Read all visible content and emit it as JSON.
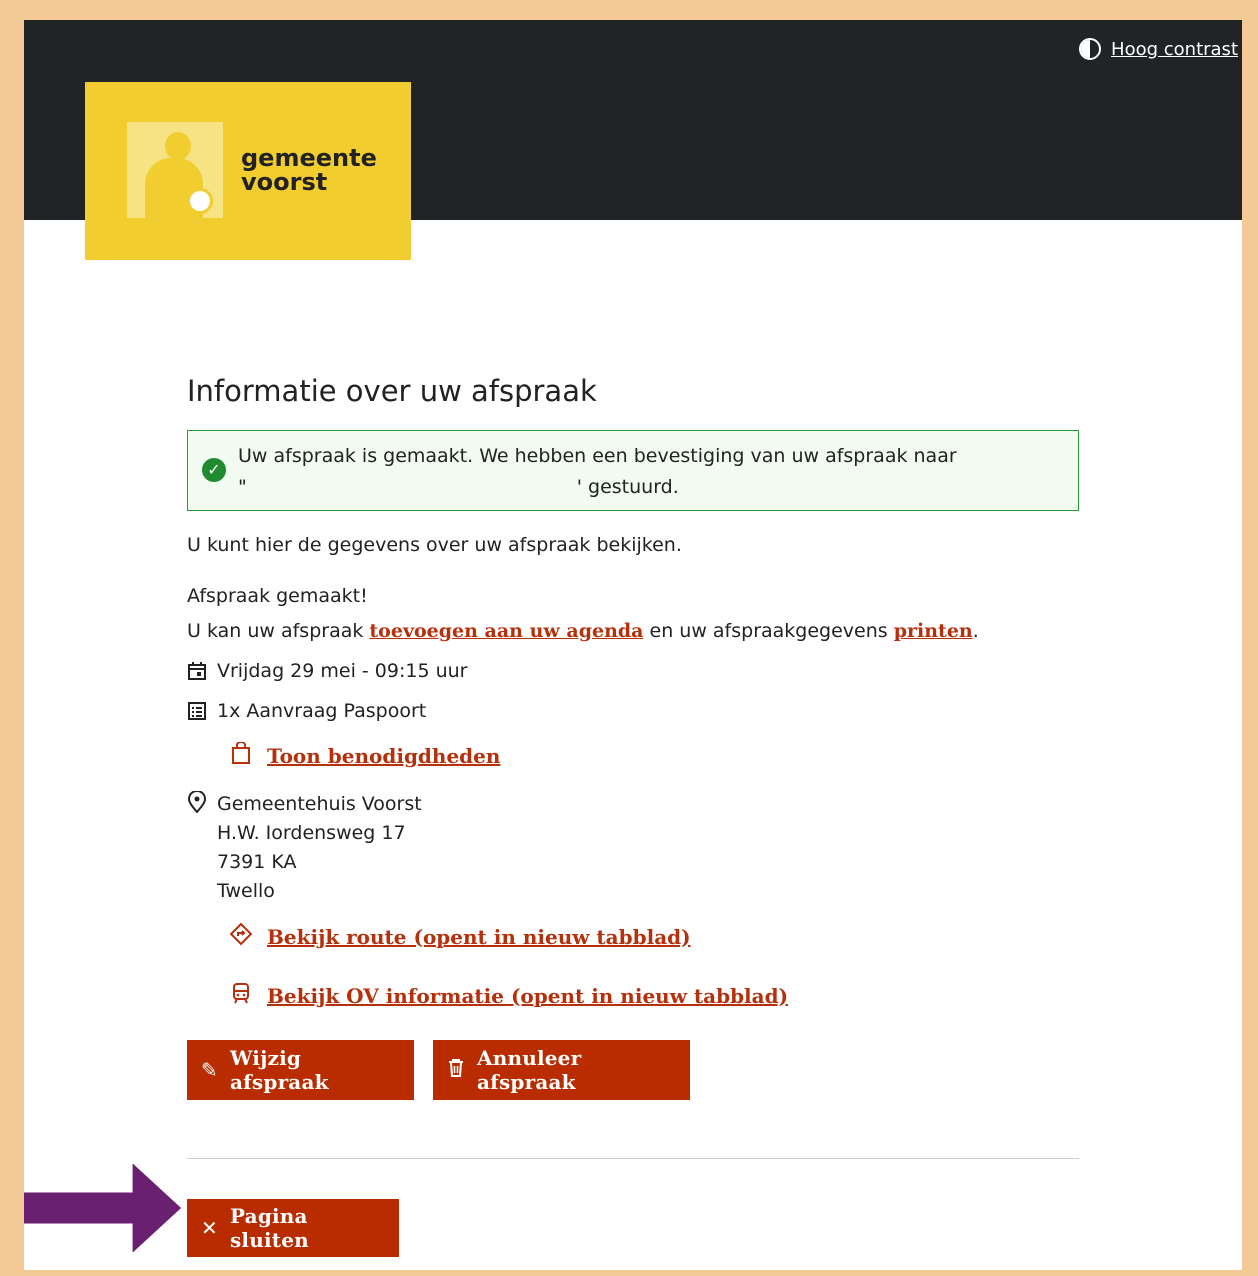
{
  "header": {
    "contrast_label": "Hoog contrast",
    "logo_line1": "gemeente",
    "logo_line2": "voorst"
  },
  "main": {
    "title": "Informatie over uw afspraak",
    "alert": {
      "line1": "Uw afspraak is gemaakt. We hebben een bevestiging van uw afspraak naar",
      "quote_open": "\"",
      "line2_end": "' gestuurd."
    },
    "intro": "U kunt hier de gegevens over uw afspraak bekijken.",
    "made": "Afspraak gemaakt!",
    "agenda_pre": "U kan uw afspraak ",
    "agenda_link": "toevoegen aan uw agenda",
    "agenda_mid": " en uw afspraakgegevens ",
    "print_link": "printen",
    "agenda_end": ".",
    "date": "Vrijdag 29 mei - 09:15 uur",
    "product": "1x Aanvraag Paspoort",
    "requirements_link": "Toon benodigdheden",
    "location": {
      "name": "Gemeentehuis Voorst",
      "street": "H.W. Iordensweg 17",
      "postcode": "7391 KA",
      "city": "Twello"
    },
    "route_link": "Bekijk route (opent in nieuw tabblad)",
    "ov_link": "Bekijk OV informatie (opent in nieuw tabblad)",
    "edit_button": "Wijzig afspraak",
    "cancel_button": "Annuleer afspraak",
    "close_button": "Pagina sluiten"
  },
  "colors": {
    "accent": "#b82c00",
    "header_bg": "#212427",
    "logo_bg": "#f2cd2f",
    "success": "#1f8a2f",
    "annotation_arrow": "#6a2070",
    "frame": "#f3c995"
  },
  "icons": [
    "contrast-icon",
    "check-circle-icon",
    "calendar-icon",
    "list-icon",
    "bag-icon",
    "location-pin-icon",
    "route-icon",
    "train-icon",
    "pencil-icon",
    "trash-icon",
    "close-icon"
  ]
}
